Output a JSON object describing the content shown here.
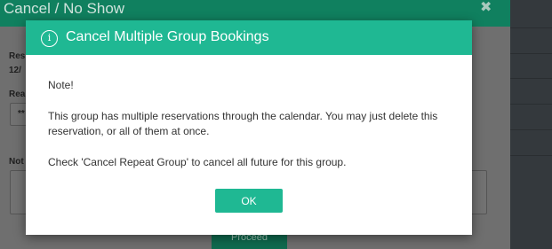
{
  "background": {
    "modal_title": "Cancel / No Show",
    "close_symbol": "✖",
    "field_labels": [
      "Res",
      "12/",
      "Rea",
      "**",
      "Not"
    ],
    "proceed_label": "Proceed"
  },
  "dialog": {
    "title": "Cancel Multiple Group Bookings",
    "icon": "info-icon",
    "note": "Note!",
    "message": "This group has multiple reservations through the calendar. You may just delete this reservation, or all of them at once.",
    "instruction": "Check 'Cancel Repeat Group' to cancel all future for this group.",
    "ok_label": "OK"
  },
  "colors": {
    "accent": "#1fb893",
    "header_dark": "#10805f"
  }
}
